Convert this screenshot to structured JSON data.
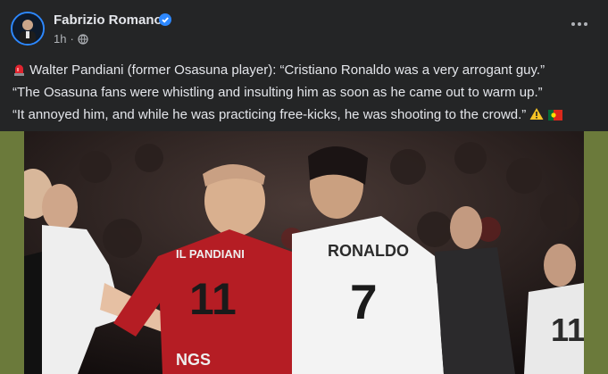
{
  "post": {
    "author": "Fabrizio Romano",
    "time": "1h",
    "separator": "·",
    "caption": [
      "Walter Pandiani (former Osasuna player): “Cristiano Ronaldo was a very arrogant guy.”",
      "“The Osasuna fans were whistling and insulting him as soon as he came out to warm up.”",
      "“It annoyed him, and while he was practicing free-kicks, he was shooting to the crowd.”"
    ]
  },
  "photo": {
    "jersey_left_name": "IL PANDIANI",
    "jersey_left_number": "11",
    "jersey_left_sponsor": "NGS",
    "jersey_right_name": "RONALDO",
    "jersey_right_number": "7",
    "jersey_far_right_number": "11"
  },
  "icons": [
    "siren-icon",
    "warning-icon",
    "portugal-flag-icon",
    "verified-icon",
    "globe-icon",
    "more-icon"
  ],
  "colors": {
    "background": "#242526",
    "verified": "#2d88ff",
    "frame": "#6b7a3b"
  }
}
